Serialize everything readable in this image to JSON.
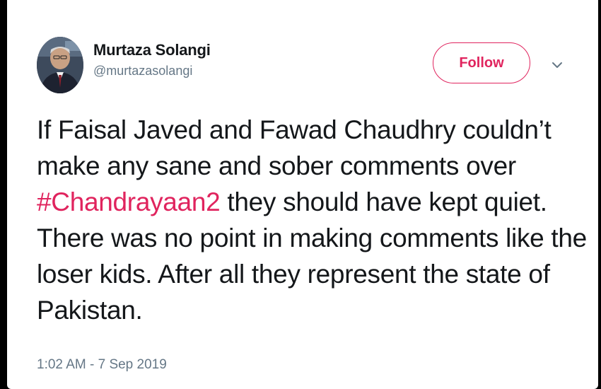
{
  "tweet": {
    "author": {
      "display_name": "Murtaza Solangi",
      "handle": "@murtazasolangi"
    },
    "follow_label": "Follow",
    "text": {
      "before": "If Faisal Javed and Fawad Chaudhry couldn’t make any sane and sober comments over ",
      "hashtag": "#Chandrayaan2",
      "after": " they should have kept quiet. There was no point in making comments like the loser kids. After all they represent the state of Pakistan."
    },
    "timestamp": "1:02 AM - 7 Sep 2019"
  },
  "colors": {
    "accent": "#e0245e",
    "text": "#14171a",
    "muted": "#657786"
  },
  "icons": {
    "more": "chevron-down-icon"
  }
}
